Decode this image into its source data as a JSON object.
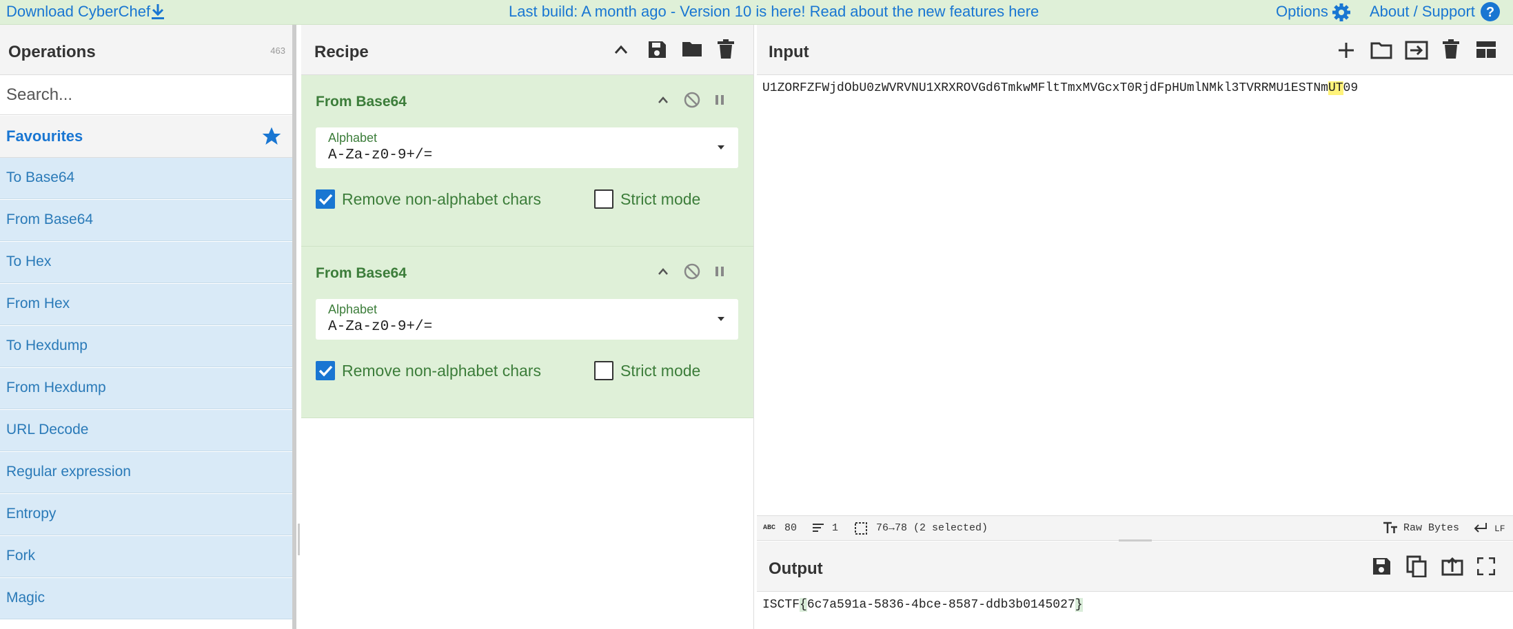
{
  "banner": {
    "download_label": "Download CyberChef",
    "build_notice": "Last build: A month ago - Version 10 is here! Read about the new features here",
    "options_label": "Options",
    "about_label": "About / Support"
  },
  "operations": {
    "title": "Operations",
    "count": "463",
    "search_placeholder": "Search...",
    "favourites_label": "Favourites",
    "items": [
      {
        "label": "To Base64"
      },
      {
        "label": "From Base64"
      },
      {
        "label": "To Hex"
      },
      {
        "label": "From Hex"
      },
      {
        "label": "To Hexdump"
      },
      {
        "label": "From Hexdump"
      },
      {
        "label": "URL Decode"
      },
      {
        "label": "Regular expression"
      },
      {
        "label": "Entropy"
      },
      {
        "label": "Fork"
      },
      {
        "label": "Magic"
      }
    ]
  },
  "recipe": {
    "title": "Recipe",
    "ingredients": [
      {
        "name": "From Base64",
        "alphabet_label": "Alphabet",
        "alphabet_value": "A-Za-z0-9+/=",
        "remove_label": "Remove non-alphabet chars",
        "remove_checked": true,
        "strict_label": "Strict mode",
        "strict_checked": false
      },
      {
        "name": "From Base64",
        "alphabet_label": "Alphabet",
        "alphabet_value": "A-Za-z0-9+/=",
        "remove_label": "Remove non-alphabet chars",
        "remove_checked": true,
        "strict_label": "Strict mode",
        "strict_checked": false
      }
    ]
  },
  "input": {
    "title": "Input",
    "text_before": "U1ZORFZFWjdObU0zWVRVNU1XRXROVGd6TmkwMFltTmxMVGcxT0RjdFpHUmlNMkl3TVRRMU1ESTNm",
    "text_highlight": "UT",
    "text_after": "09"
  },
  "status": {
    "abc_label": "ABC",
    "length": "80",
    "lines": "1",
    "selection": "76→78 (2 selected)",
    "encoding": "Raw Bytes",
    "eol": "LF"
  },
  "output": {
    "title": "Output",
    "text_prefix": "ISCTF",
    "brace_open": "{",
    "text_body": "6c7a591a-5836-4bce-8587-ddb3b0145027",
    "brace_close": "}"
  },
  "colors": {
    "accent": "#1976d2",
    "recipe_green": "#dff0d8",
    "op_blue": "#d9eaf7",
    "highlight": "#fff37a"
  }
}
